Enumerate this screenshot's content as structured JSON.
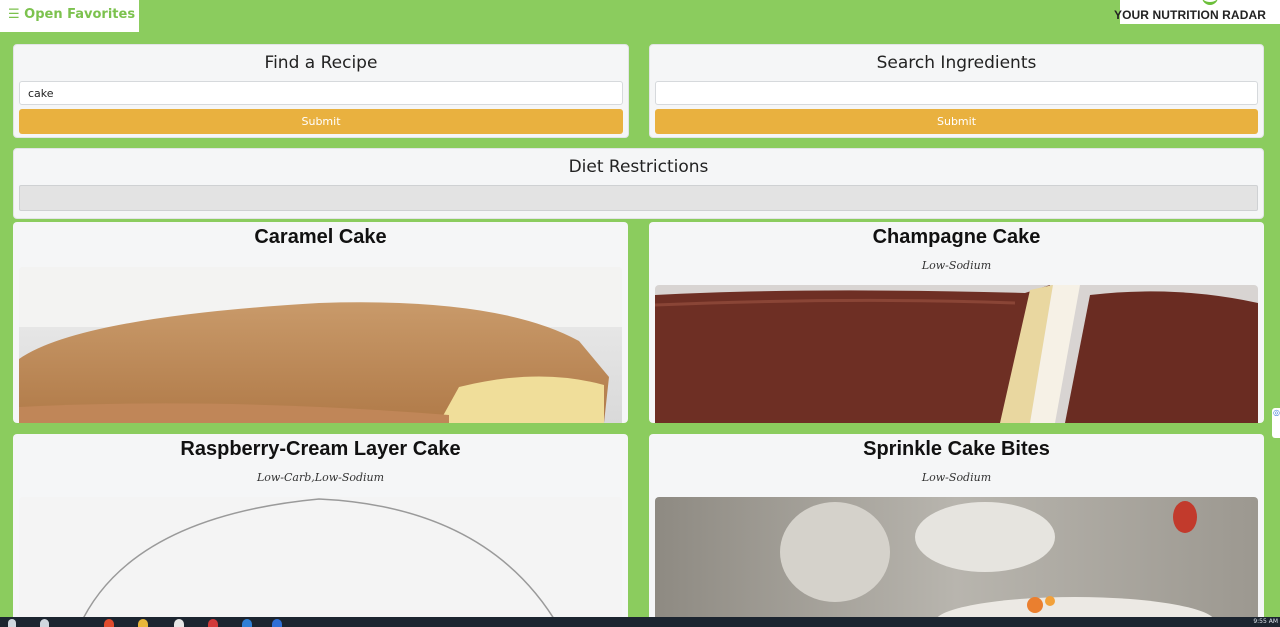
{
  "header": {
    "favorites_link": "☰ Open Favorites",
    "brand": "YOUR NUTRITION RADAR"
  },
  "find_recipe": {
    "title": "Find a Recipe",
    "value": "cake",
    "submit_label": "Submit"
  },
  "search_ingredients": {
    "title": "Search Ingredients",
    "value": "",
    "submit_label": "Submit"
  },
  "diet_restrictions": {
    "title": "Diet Restrictions"
  },
  "recipes": [
    {
      "title": "Caramel Cake",
      "diet": ""
    },
    {
      "title": "Champagne Cake",
      "diet": "Low-Sodium"
    },
    {
      "title": "Raspberry-Cream Layer Cake",
      "diet": "Low-Carb,Low-Sodium"
    },
    {
      "title": "Sprinkle Cake Bites",
      "diet": "Low-Sodium"
    }
  ],
  "colors": {
    "background_green": "#8bcc5e",
    "button_orange": "#e9b13f",
    "panel_bg": "#f5f6f7"
  },
  "taskbar": {
    "clock": "9:55 AM"
  }
}
